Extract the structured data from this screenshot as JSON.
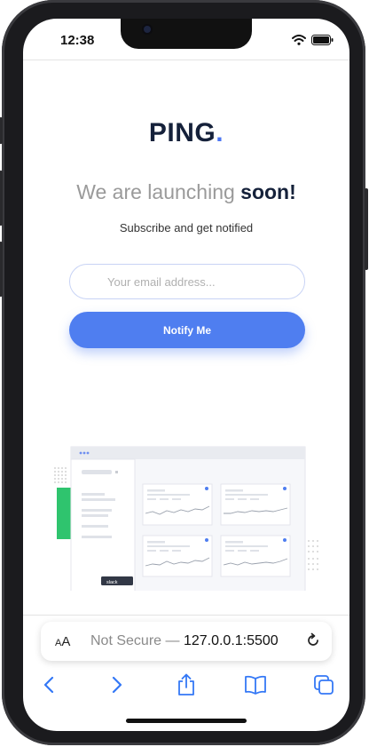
{
  "status": {
    "time": "12:38"
  },
  "brand": {
    "name": "PING",
    "dot": ".",
    "accent": "#4b76f2"
  },
  "hero": {
    "headline_light": "We are launching ",
    "headline_bold": "soon!",
    "subline": "Subscribe and get notified"
  },
  "form": {
    "email_placeholder": "Your email address...",
    "submit_label": "Notify Me",
    "button_color": "#4f7ef0"
  },
  "illustration": {
    "slack_label": "slack"
  },
  "browser": {
    "aa_label_small": "A",
    "aa_label_big": "A",
    "security": "Not Secure —",
    "host": "127.0.0.1:5500"
  },
  "icons": {
    "back": "chevron-left-icon",
    "forward": "chevron-right-icon",
    "share": "share-icon",
    "bookmarks": "book-icon",
    "tabs": "tabs-icon"
  }
}
